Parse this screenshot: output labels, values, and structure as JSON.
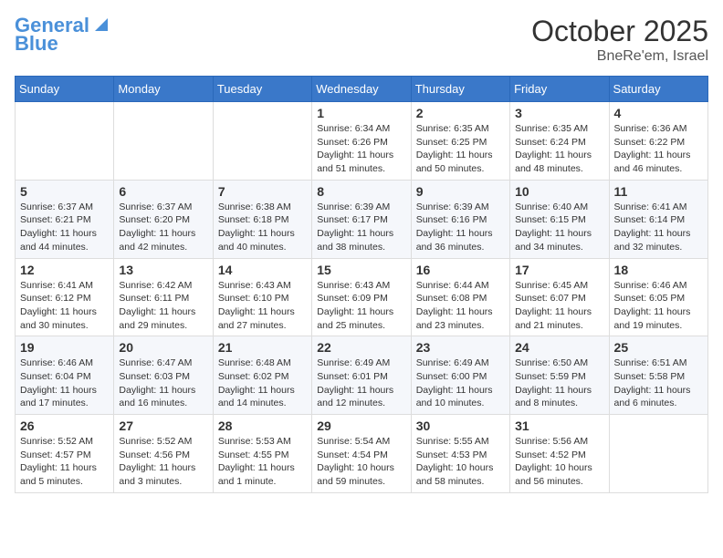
{
  "header": {
    "logo_line1": "General",
    "logo_line2": "Blue",
    "month": "October 2025",
    "location": "BneRe'em, Israel"
  },
  "weekdays": [
    "Sunday",
    "Monday",
    "Tuesday",
    "Wednesday",
    "Thursday",
    "Friday",
    "Saturday"
  ],
  "weeks": [
    [
      {
        "day": "",
        "info": ""
      },
      {
        "day": "",
        "info": ""
      },
      {
        "day": "",
        "info": ""
      },
      {
        "day": "1",
        "info": "Sunrise: 6:34 AM\nSunset: 6:26 PM\nDaylight: 11 hours\nand 51 minutes."
      },
      {
        "day": "2",
        "info": "Sunrise: 6:35 AM\nSunset: 6:25 PM\nDaylight: 11 hours\nand 50 minutes."
      },
      {
        "day": "3",
        "info": "Sunrise: 6:35 AM\nSunset: 6:24 PM\nDaylight: 11 hours\nand 48 minutes."
      },
      {
        "day": "4",
        "info": "Sunrise: 6:36 AM\nSunset: 6:22 PM\nDaylight: 11 hours\nand 46 minutes."
      }
    ],
    [
      {
        "day": "5",
        "info": "Sunrise: 6:37 AM\nSunset: 6:21 PM\nDaylight: 11 hours\nand 44 minutes."
      },
      {
        "day": "6",
        "info": "Sunrise: 6:37 AM\nSunset: 6:20 PM\nDaylight: 11 hours\nand 42 minutes."
      },
      {
        "day": "7",
        "info": "Sunrise: 6:38 AM\nSunset: 6:18 PM\nDaylight: 11 hours\nand 40 minutes."
      },
      {
        "day": "8",
        "info": "Sunrise: 6:39 AM\nSunset: 6:17 PM\nDaylight: 11 hours\nand 38 minutes."
      },
      {
        "day": "9",
        "info": "Sunrise: 6:39 AM\nSunset: 6:16 PM\nDaylight: 11 hours\nand 36 minutes."
      },
      {
        "day": "10",
        "info": "Sunrise: 6:40 AM\nSunset: 6:15 PM\nDaylight: 11 hours\nand 34 minutes."
      },
      {
        "day": "11",
        "info": "Sunrise: 6:41 AM\nSunset: 6:14 PM\nDaylight: 11 hours\nand 32 minutes."
      }
    ],
    [
      {
        "day": "12",
        "info": "Sunrise: 6:41 AM\nSunset: 6:12 PM\nDaylight: 11 hours\nand 30 minutes."
      },
      {
        "day": "13",
        "info": "Sunrise: 6:42 AM\nSunset: 6:11 PM\nDaylight: 11 hours\nand 29 minutes."
      },
      {
        "day": "14",
        "info": "Sunrise: 6:43 AM\nSunset: 6:10 PM\nDaylight: 11 hours\nand 27 minutes."
      },
      {
        "day": "15",
        "info": "Sunrise: 6:43 AM\nSunset: 6:09 PM\nDaylight: 11 hours\nand 25 minutes."
      },
      {
        "day": "16",
        "info": "Sunrise: 6:44 AM\nSunset: 6:08 PM\nDaylight: 11 hours\nand 23 minutes."
      },
      {
        "day": "17",
        "info": "Sunrise: 6:45 AM\nSunset: 6:07 PM\nDaylight: 11 hours\nand 21 minutes."
      },
      {
        "day": "18",
        "info": "Sunrise: 6:46 AM\nSunset: 6:05 PM\nDaylight: 11 hours\nand 19 minutes."
      }
    ],
    [
      {
        "day": "19",
        "info": "Sunrise: 6:46 AM\nSunset: 6:04 PM\nDaylight: 11 hours\nand 17 minutes."
      },
      {
        "day": "20",
        "info": "Sunrise: 6:47 AM\nSunset: 6:03 PM\nDaylight: 11 hours\nand 16 minutes."
      },
      {
        "day": "21",
        "info": "Sunrise: 6:48 AM\nSunset: 6:02 PM\nDaylight: 11 hours\nand 14 minutes."
      },
      {
        "day": "22",
        "info": "Sunrise: 6:49 AM\nSunset: 6:01 PM\nDaylight: 11 hours\nand 12 minutes."
      },
      {
        "day": "23",
        "info": "Sunrise: 6:49 AM\nSunset: 6:00 PM\nDaylight: 11 hours\nand 10 minutes."
      },
      {
        "day": "24",
        "info": "Sunrise: 6:50 AM\nSunset: 5:59 PM\nDaylight: 11 hours\nand 8 minutes."
      },
      {
        "day": "25",
        "info": "Sunrise: 6:51 AM\nSunset: 5:58 PM\nDaylight: 11 hours\nand 6 minutes."
      }
    ],
    [
      {
        "day": "26",
        "info": "Sunrise: 5:52 AM\nSunset: 4:57 PM\nDaylight: 11 hours\nand 5 minutes."
      },
      {
        "day": "27",
        "info": "Sunrise: 5:52 AM\nSunset: 4:56 PM\nDaylight: 11 hours\nand 3 minutes."
      },
      {
        "day": "28",
        "info": "Sunrise: 5:53 AM\nSunset: 4:55 PM\nDaylight: 11 hours\nand 1 minute."
      },
      {
        "day": "29",
        "info": "Sunrise: 5:54 AM\nSunset: 4:54 PM\nDaylight: 10 hours\nand 59 minutes."
      },
      {
        "day": "30",
        "info": "Sunrise: 5:55 AM\nSunset: 4:53 PM\nDaylight: 10 hours\nand 58 minutes."
      },
      {
        "day": "31",
        "info": "Sunrise: 5:56 AM\nSunset: 4:52 PM\nDaylight: 10 hours\nand 56 minutes."
      },
      {
        "day": "",
        "info": ""
      }
    ]
  ]
}
